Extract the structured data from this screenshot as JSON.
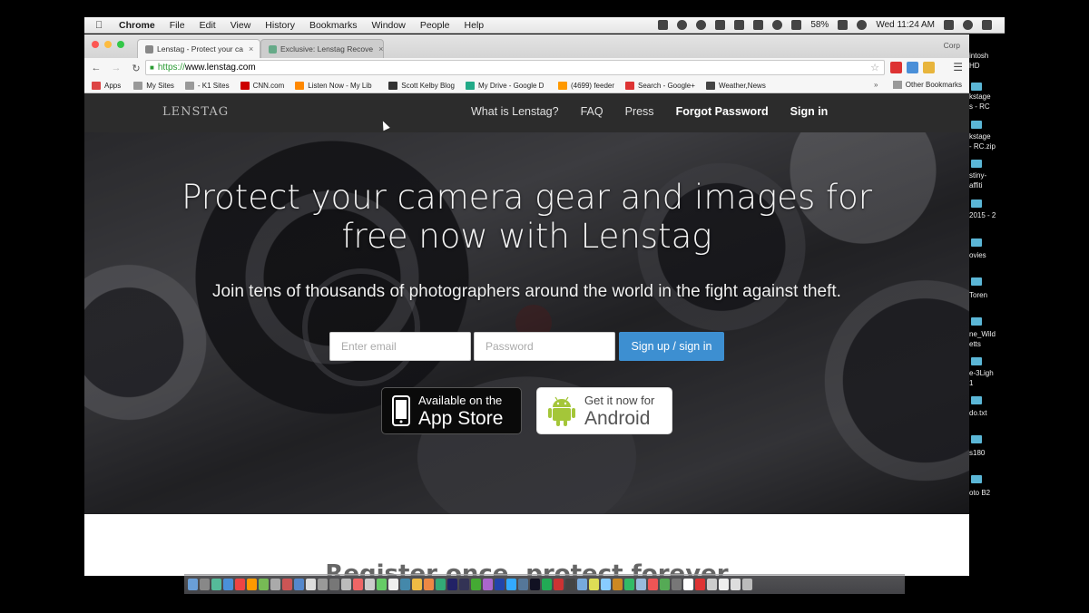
{
  "menubar": {
    "app": "Chrome",
    "items": [
      "File",
      "Edit",
      "View",
      "History",
      "Bookmarks",
      "Window",
      "People",
      "Help"
    ],
    "battery": "58%",
    "clock": "Wed 11:24 AM"
  },
  "desktop": {
    "labels": [
      "intosh",
      "HD",
      "kstage",
      "s - RC",
      "kstage",
      "- RC.zip",
      "stiny-",
      "affiti",
      "2015 - 2",
      "ovies",
      "Toren",
      "ne_Wild",
      "etts",
      "e-3Ligh",
      "1",
      "do.txt",
      "s180",
      "oto B2"
    ]
  },
  "browser": {
    "tabs": [
      {
        "title": "Lenstag - Protect your ca",
        "active": true
      },
      {
        "title": "Exclusive: Lenstag Recove",
        "active": false
      }
    ],
    "profile": "Corp",
    "url_scheme": "https://",
    "url_rest": "www.lenstag.com",
    "bookmarks": [
      {
        "label": "Apps",
        "color": "#d44"
      },
      {
        "label": "My Sites",
        "color": "#999"
      },
      {
        "label": "- K1 Sites",
        "color": "#999"
      },
      {
        "label": "CNN.com",
        "color": "#c00"
      },
      {
        "label": "Listen Now - My Lib",
        "color": "#f80"
      },
      {
        "label": "Scott Kelby Blog",
        "color": "#333"
      },
      {
        "label": "My Drive - Google D",
        "color": "#2a8"
      },
      {
        "label": "(4699) feeder",
        "color": "#f90"
      },
      {
        "label": "Search - Google+",
        "color": "#d33"
      },
      {
        "label": "Weather,News",
        "color": "#444"
      }
    ],
    "more_bookmarks": "»",
    "other_bookmarks": "Other Bookmarks"
  },
  "site": {
    "logo": "LENSTAG",
    "nav": {
      "what": "What is Lenstag?",
      "faq": "FAQ",
      "press": "Press",
      "forgot": "Forgot Password",
      "signin": "Sign in"
    },
    "headline_line1": "Protect your camera gear and images for",
    "headline_line2": "free now with Lenstag",
    "subhead": "Join tens of thousands of photographers around the world in the fight against theft.",
    "form": {
      "email_placeholder": "Enter email",
      "password_placeholder": "Password",
      "submit_label": "Sign up / sign in"
    },
    "appstore": {
      "line1": "Available on the",
      "line2": "App Store"
    },
    "android": {
      "line1": "Get it now for",
      "line2": "Android"
    },
    "section_heading": "Register once, protect forever"
  },
  "colors": {
    "nav_bg": "#2c2c2c",
    "signup_button": "#3d8fd1",
    "android_green": "#a4c639"
  }
}
